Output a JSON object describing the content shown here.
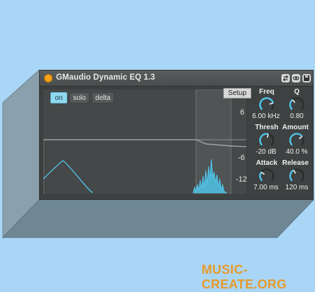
{
  "window": {
    "title": "GMaudio Dynamic EQ 1.3"
  },
  "modes": [
    {
      "label": "on",
      "active": true
    },
    {
      "label": "solo",
      "active": false
    },
    {
      "label": "delta",
      "active": false
    }
  ],
  "setup_label": "Setup",
  "scale_labels": [
    "6",
    "-6",
    "-12"
  ],
  "controls": {
    "freq": {
      "label": "Freq",
      "value": "6.00 kHz",
      "level": 0.78
    },
    "q": {
      "label": "Q",
      "value": "0.80",
      "level": 0.35
    },
    "thresh": {
      "label": "Thresh",
      "value": "-20 dB",
      "level": 0.55
    },
    "amount": {
      "label": "Amount",
      "value": "40.0 %",
      "level": 0.7
    },
    "attack": {
      "label": "Attack",
      "value": "7.00 ms",
      "level": 0.3
    },
    "release": {
      "label": "Release",
      "value": "120 ms",
      "level": 0.4
    }
  },
  "colors": {
    "accent": "#4fc3e8",
    "power": "#f6a21a",
    "background": "#a9d6f7"
  },
  "watermark": "MUSIC-CREATE.ORG"
}
